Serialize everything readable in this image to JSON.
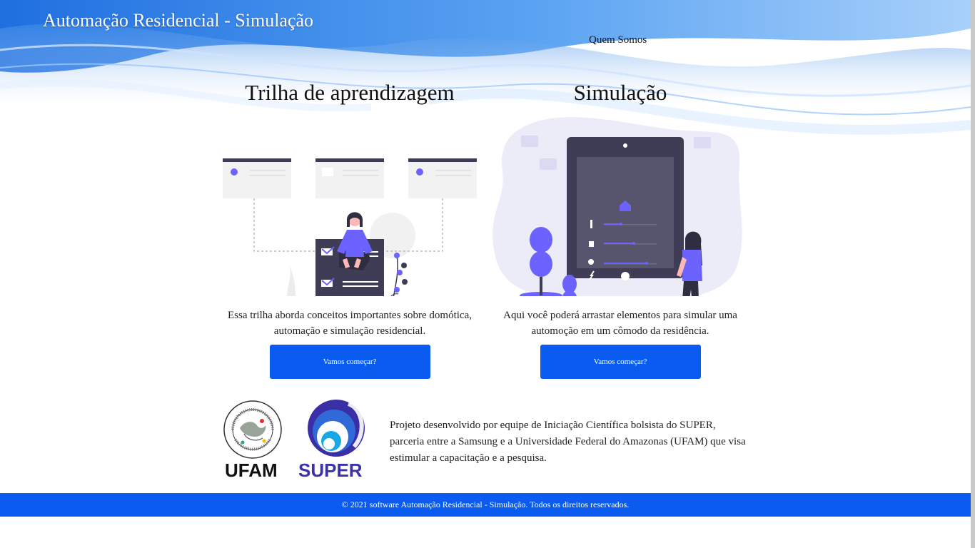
{
  "header": {
    "site_title": "Automação Residencial - Simulação",
    "nav_quem_somos": "Quem Somos"
  },
  "cards": [
    {
      "title": "Trilha de aprendizagem",
      "description": "Essa trilha aborda conceitos importantes sobre domótica, automação e simulação residencial.",
      "button_label": "Vamos começar?"
    },
    {
      "title": "Simulação",
      "description": "Aqui você poderá arrastar elementos para simular uma automoção em um cômodo da residência.",
      "button_label": "Vamos começar?"
    }
  ],
  "partners": {
    "ufam_label": "UFAM",
    "super_label": "SUPER",
    "ufam_seal_text": "UNIVERSIDADE FEDERAL DO AMAZONAS · IN UNIVERSA SCIENTIA VERITAS",
    "about_text": "Projeto desenvolvido por equipe de Iniciação Científica bolsista do SUPER, parceria entre a Samsung e a Universidade Federal do Amazonas (UFAM) que visa estimular a capacitação e a pesquisa."
  },
  "footer": {
    "copyright": "© 2021 software Automação Residencial - Simulação. Todos os direitos reservados."
  },
  "colors": {
    "primary_blue": "#0a5cf0",
    "accent_purple": "#6c63ff",
    "dark_slate": "#3f3d56"
  }
}
